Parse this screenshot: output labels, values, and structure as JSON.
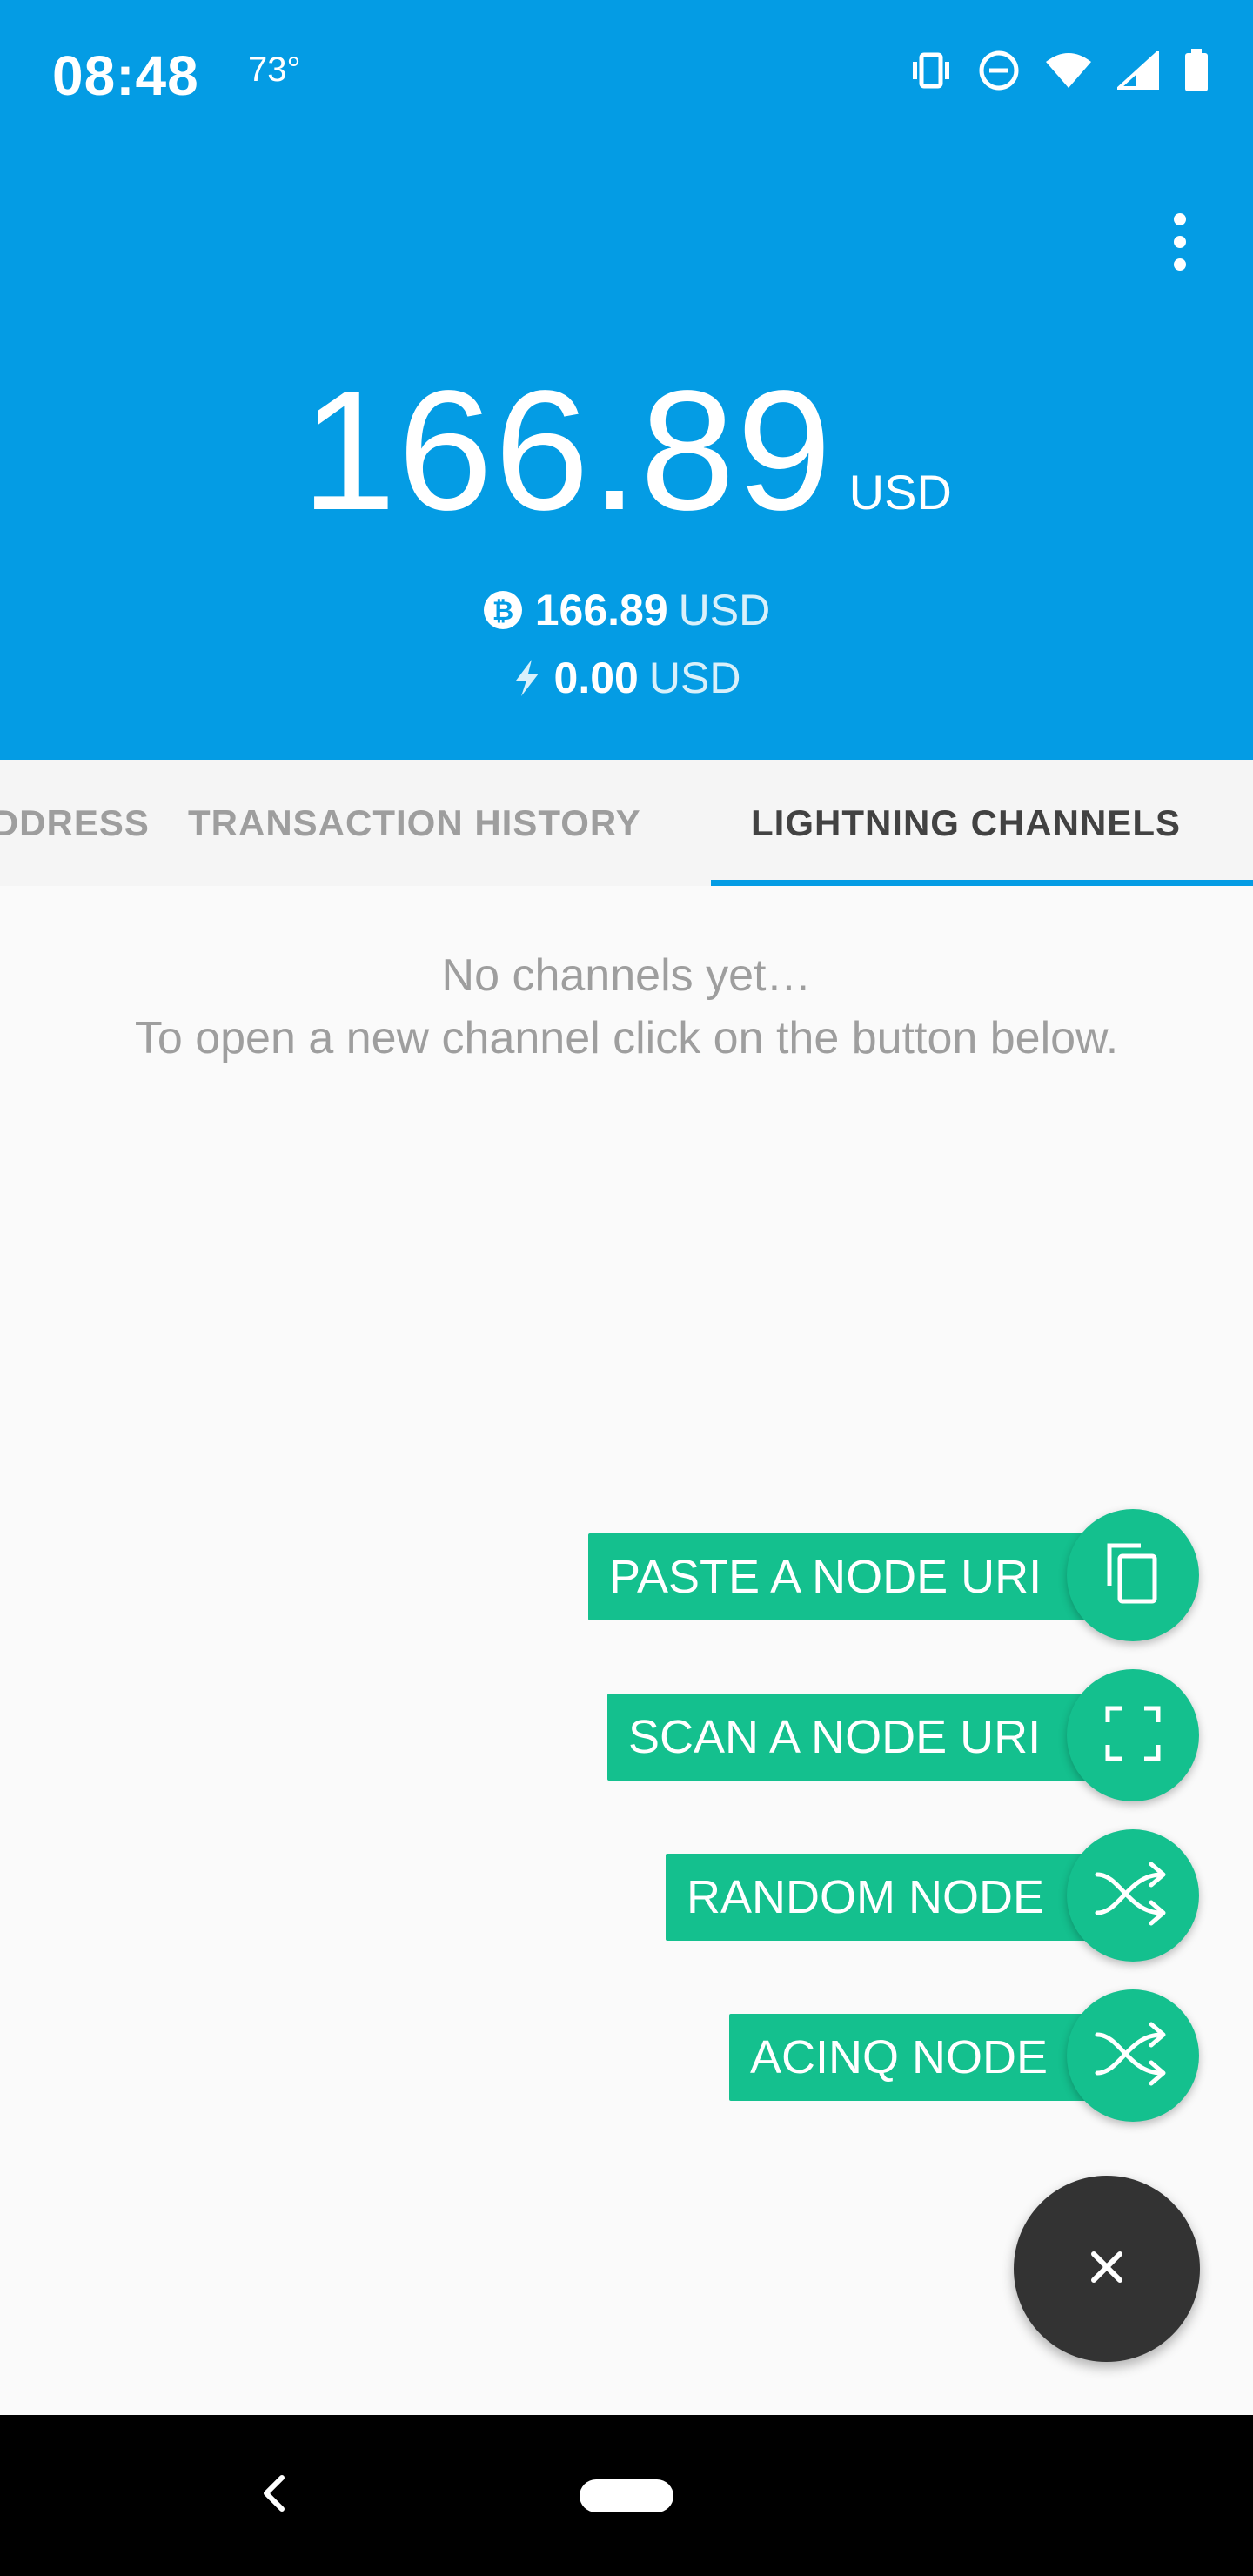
{
  "status_bar": {
    "time": "08:48",
    "temperature": "73°",
    "icons": [
      "vibrate-icon",
      "dnd-icon",
      "wifi-icon",
      "signal-icon",
      "battery-icon"
    ]
  },
  "header": {
    "background": "#049ce4",
    "balance": {
      "amount": "166.89",
      "unit": "USD"
    },
    "onchain": {
      "icon": "bitcoin-icon",
      "amount": "166.89",
      "unit": "USD"
    },
    "lightning": {
      "icon": "lightning-icon",
      "amount": "0.00",
      "unit": "USD"
    },
    "menu_icon": "more-vert-icon"
  },
  "tabs": [
    {
      "label": "RECEIVE ADDRESS",
      "visible_text": "RESS",
      "active": false
    },
    {
      "label": "TRANSACTION HISTORY",
      "active": false
    },
    {
      "label": "LIGHTNING CHANNELS",
      "active": true
    }
  ],
  "empty_state": {
    "line1": "No channels yet…",
    "line2": "To open a new channel click on the button below."
  },
  "speed_dial": {
    "accent": "#14c08e",
    "items": [
      {
        "label": "PASTE A NODE URI",
        "icon": "copy-icon"
      },
      {
        "label": "SCAN A NODE URI",
        "icon": "scan-icon"
      },
      {
        "label": "RANDOM NODE",
        "icon": "shuffle-icon"
      },
      {
        "label": "ACINQ NODE",
        "icon": "shuffle-icon"
      }
    ],
    "close_icon": "close-icon"
  },
  "nav_bar": {
    "back_icon": "back-icon",
    "home": "home-pill"
  }
}
